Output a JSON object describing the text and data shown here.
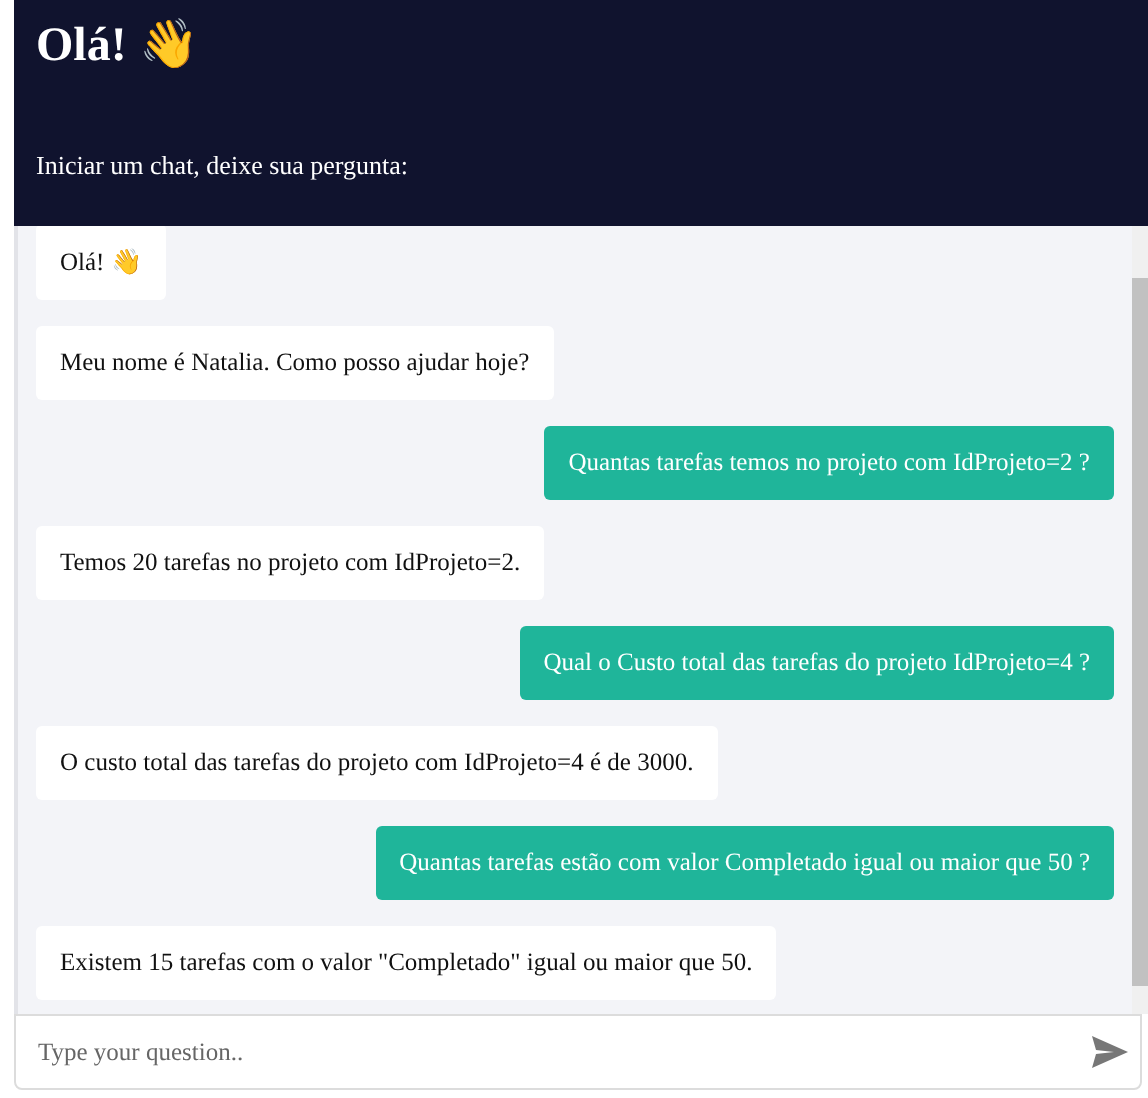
{
  "header": {
    "title": "Olá! 👋",
    "subtitle": "Iniciar um chat, deixe sua pergunta:"
  },
  "messages": [
    {
      "kind": "bot",
      "text": "Olá! 👋"
    },
    {
      "kind": "bot",
      "text": "Meu nome é Natalia. Como posso ajudar hoje?"
    },
    {
      "kind": "user",
      "text": "Quantas tarefas temos no projeto com IdProjeto=2 ?"
    },
    {
      "kind": "bot",
      "text": "Temos 20 tarefas no projeto com IdProjeto=2."
    },
    {
      "kind": "user",
      "text": "Qual o Custo total das tarefas do projeto IdProjeto=4 ?"
    },
    {
      "kind": "bot",
      "text": "O custo total das tarefas do projeto com IdProjeto=4 é de 3000."
    },
    {
      "kind": "user",
      "text": "Quantas tarefas estão com valor Completado igual ou maior que 50 ?"
    },
    {
      "kind": "bot",
      "text": "Existem 15 tarefas com o valor \"Completado\" igual ou maior que 50."
    }
  ],
  "input": {
    "placeholder": "Type your question.."
  }
}
